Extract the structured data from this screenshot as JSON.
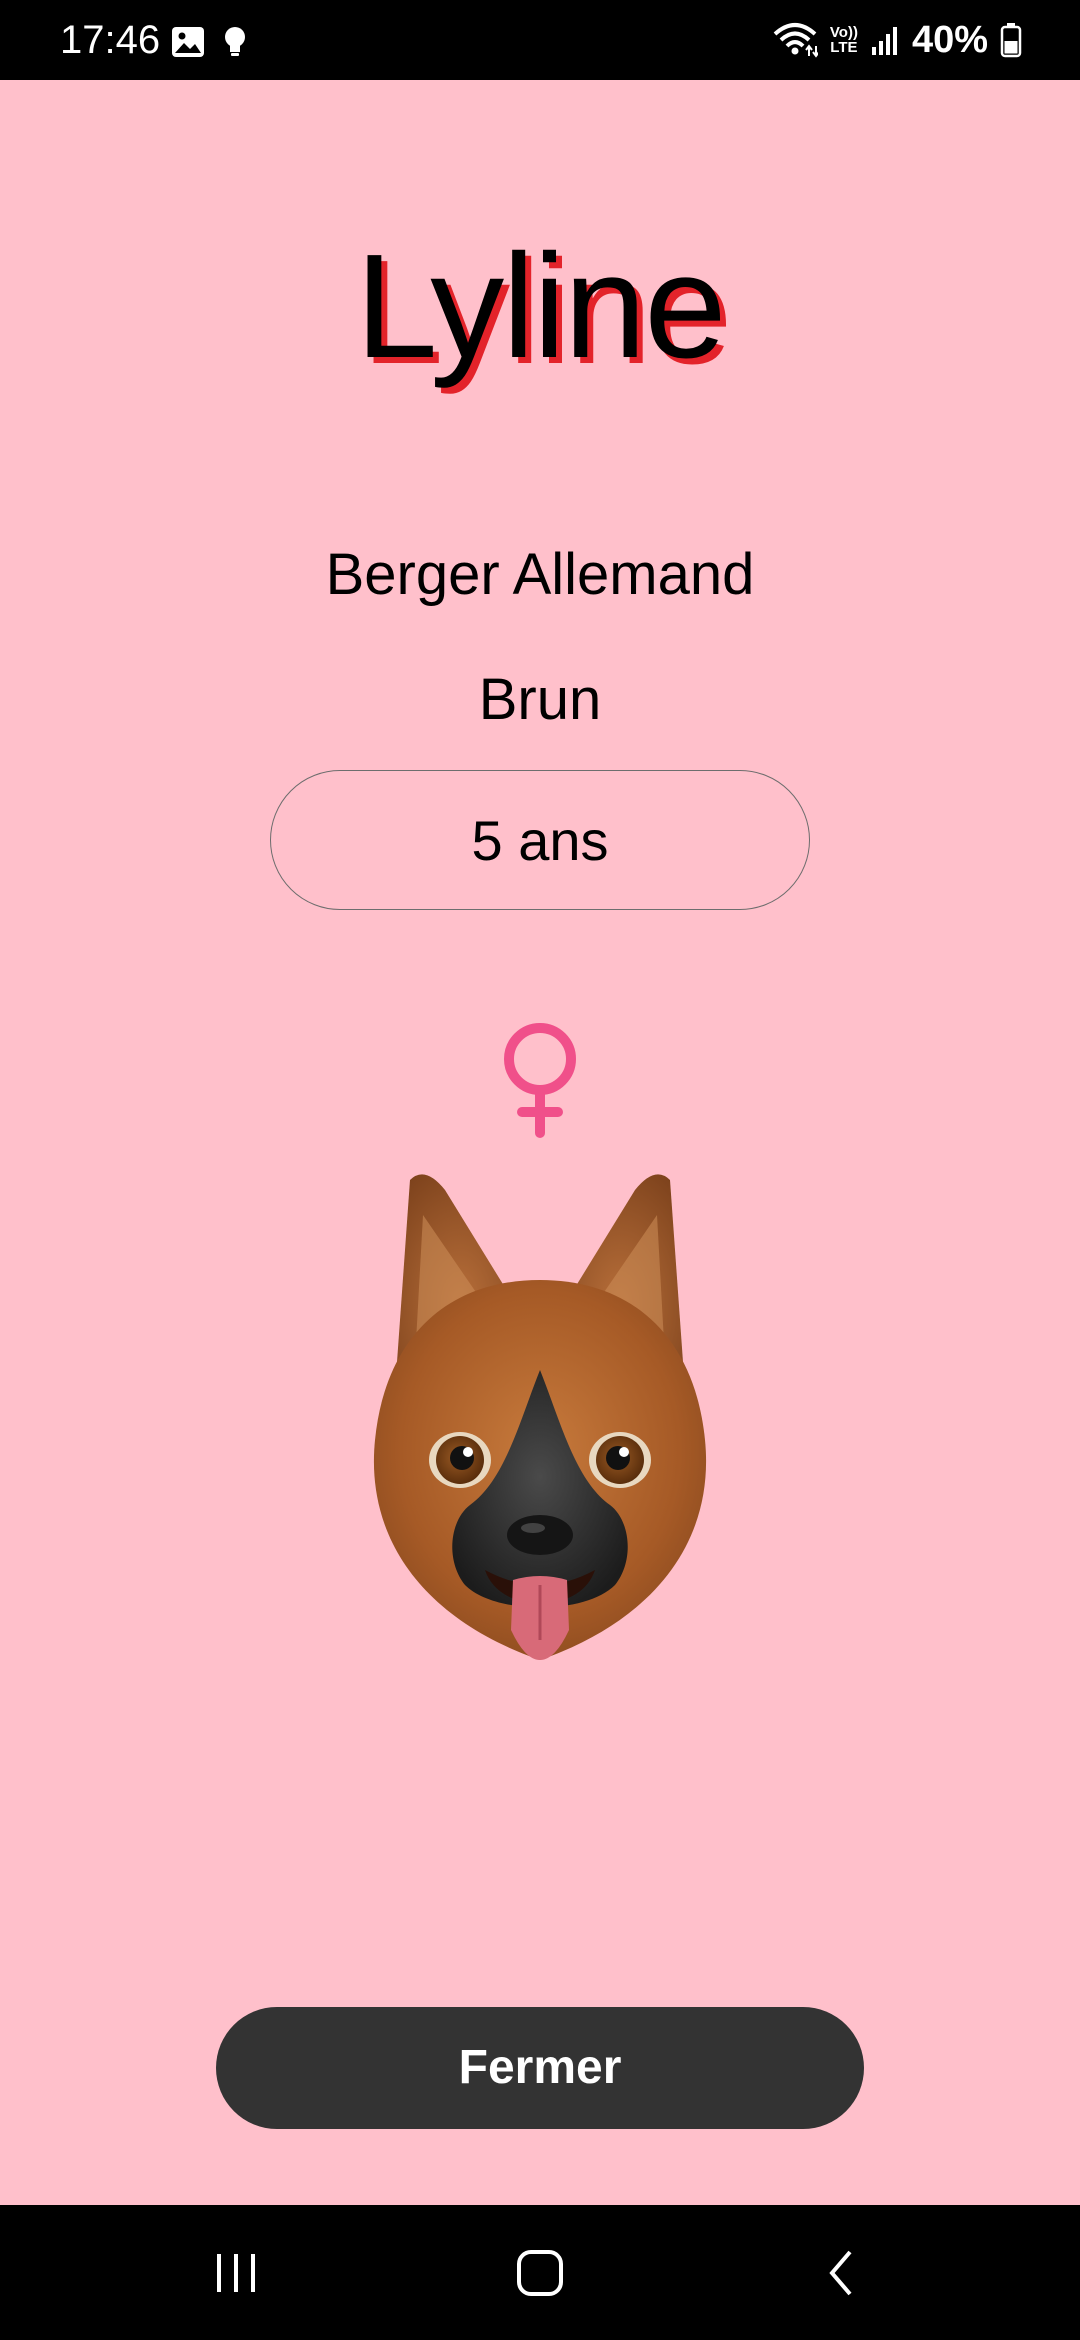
{
  "status_bar": {
    "time": "17:46",
    "battery": "40%",
    "network_label_top": "Vo))",
    "network_label_bottom": "LTE",
    "icons": [
      "gallery-icon",
      "bulb-icon",
      "wifi-icon",
      "signal-icon",
      "battery-icon"
    ]
  },
  "pet": {
    "name": "Lyline",
    "breed": "Berger Allemand",
    "color": "Brun",
    "age": "5 ans",
    "gender_icon": "female-icon",
    "avatar_icon": "german-shepherd-avatar"
  },
  "actions": {
    "close_label": "Fermer"
  },
  "nav_bar": {
    "icons": [
      "recent-apps-icon",
      "home-icon",
      "back-icon"
    ]
  },
  "colors": {
    "background": "#ffc0cb",
    "name_shadow": "#e3232a",
    "gender": "#f0508a",
    "button_bg": "#333333"
  }
}
